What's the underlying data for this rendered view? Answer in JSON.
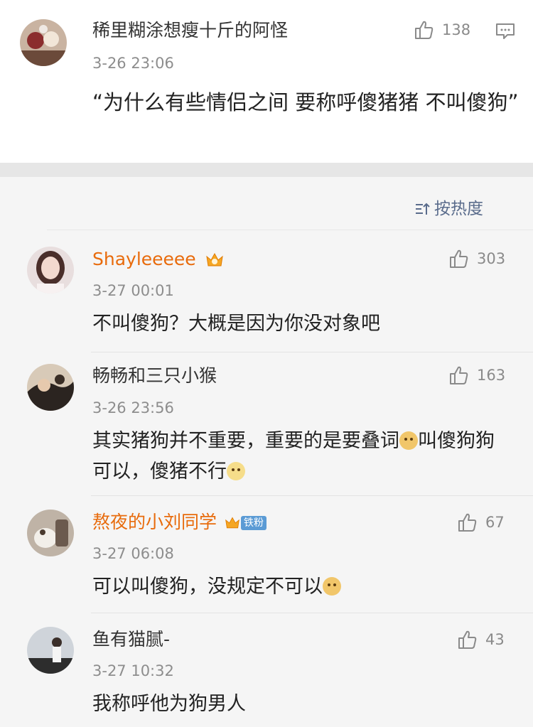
{
  "post": {
    "author": "稀里糊涂想瘦十斤的阿怪",
    "time": "3-26 23:06",
    "likes": "138",
    "text": "“为什么有些情侣之间 要称呼傻猪猪 不叫傻狗”"
  },
  "sort": {
    "label": "按热度"
  },
  "comments": [
    {
      "name": "Shayleeeee",
      "time": "3-27 00:01",
      "likes": "303",
      "text": "不叫傻狗？大概是因为你没对象吧"
    },
    {
      "name": "畅畅和三只小猴",
      "time": "3-26 23:56",
      "likes": "163",
      "text_a": "其实猪狗并不重要，重要的是要叠词",
      "text_b": "叫傻狗狗可以，傻猪不行"
    },
    {
      "name": "熬夜的小刘同学",
      "badge": "铁粉",
      "time": "3-27 06:08",
      "likes": "67",
      "text": "可以叫傻狗，没规定不可以"
    },
    {
      "name": "鱼有猫腻-",
      "time": "3-27 10:32",
      "likes": "43",
      "text": "我称呼他为狗男人"
    }
  ],
  "icons": {
    "like": "thumbs-up-icon",
    "reply": "comment-icon",
    "sort": "sort-icon",
    "vip": "crown-icon"
  },
  "colors": {
    "vip_name": "#e86b0c",
    "sort_label": "#5a6c8c",
    "badge_blue": "#5b9bd5"
  }
}
